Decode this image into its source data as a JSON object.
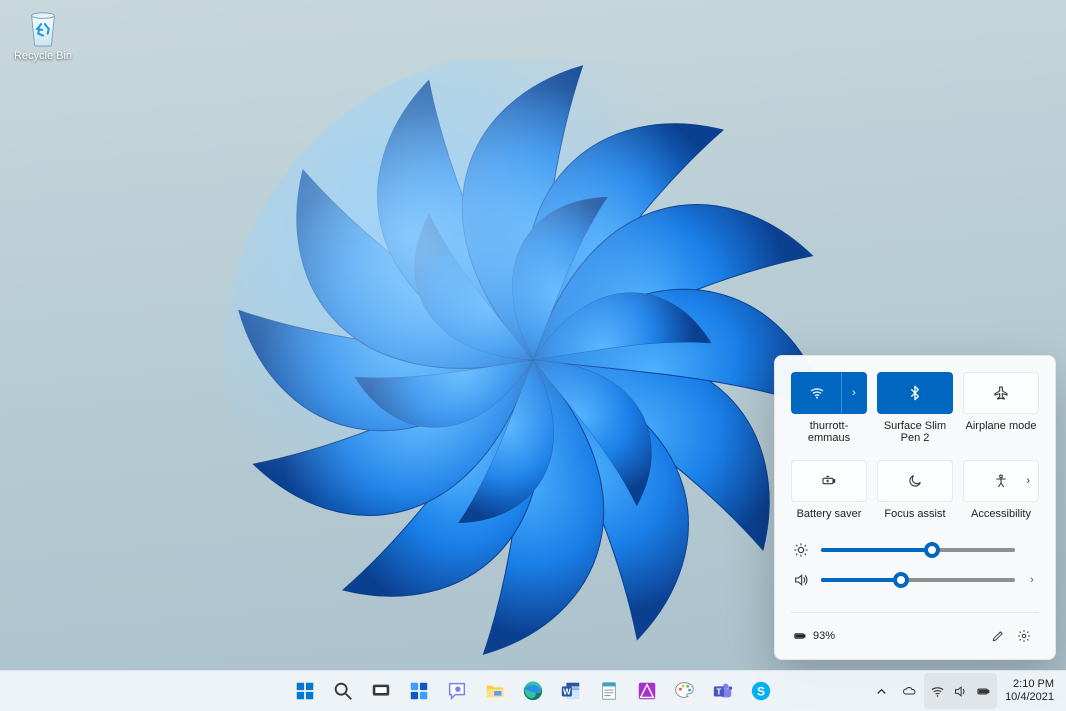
{
  "desktop": {
    "recycle_bin_label": "Recycle Bin"
  },
  "quick_settings": {
    "tiles": {
      "wifi": {
        "label": "thurrott-emmaus",
        "active": true,
        "has_arrow": true
      },
      "bluetooth": {
        "label": "Surface Slim Pen 2",
        "active": true,
        "has_arrow": false
      },
      "airplane": {
        "label": "Airplane mode",
        "active": false,
        "has_arrow": false
      },
      "battery_saver": {
        "label": "Battery saver",
        "active": false,
        "has_arrow": false
      },
      "focus_assist": {
        "label": "Focus assist",
        "active": false,
        "has_arrow": false
      },
      "accessibility": {
        "label": "Accessibility",
        "active": false,
        "has_arrow": true
      }
    },
    "sliders": {
      "brightness": {
        "value": 57
      },
      "volume": {
        "value": 41
      }
    },
    "battery_text": "93%"
  },
  "taskbar": {
    "apps": [
      "start",
      "search",
      "task-view",
      "widgets",
      "chat",
      "file-explorer",
      "edge",
      "word",
      "notepad",
      "affinity",
      "paint",
      "teams",
      "skype"
    ],
    "tray": {
      "time": "2:10 PM",
      "date": "10/4/2021"
    }
  }
}
